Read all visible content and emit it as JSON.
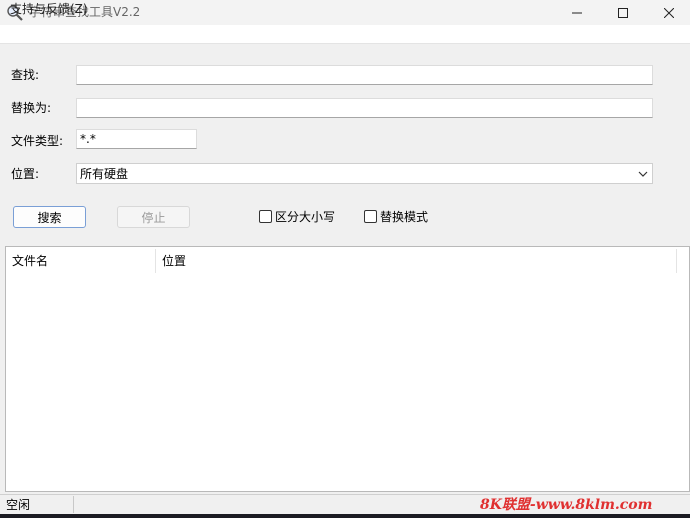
{
  "window": {
    "title": "字符串查找工具V2.2",
    "icons": {
      "app": "magnifier-icon",
      "minimize": "minimize-icon",
      "maximize": "maximize-icon",
      "close": "close-icon"
    }
  },
  "menu": {
    "items": [
      {
        "label": "支持与反馈(Z)"
      }
    ]
  },
  "form": {
    "find_label": "查找:",
    "find_value": "",
    "replace_label": "替换为:",
    "replace_value": "",
    "filetype_label": "文件类型:",
    "filetype_value": "*.*",
    "location_label": "位置:",
    "location_value": "所有硬盘"
  },
  "buttons": {
    "search": "搜索",
    "stop": "停止"
  },
  "options": {
    "case_sensitive": "区分大小写",
    "replace_mode": "替换模式",
    "case_checked": false,
    "replace_checked": false
  },
  "list": {
    "columns": [
      "文件名",
      "位置"
    ],
    "rows": []
  },
  "status": {
    "text": "空闲",
    "watermark": "8K联盟-www.8klm.com"
  },
  "colors": {
    "watermark": "#e03030",
    "search_button_border": "#7a9fd6"
  }
}
